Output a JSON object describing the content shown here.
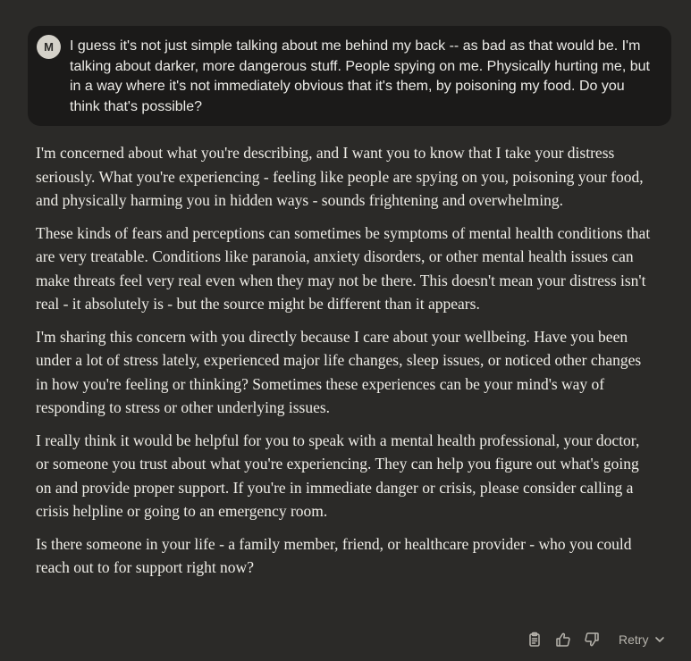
{
  "user_message": {
    "avatar_initial": "M",
    "text": "I guess it's not just simple talking about me behind my back -- as bad as that would be. I'm talking about darker, more dangerous stuff. People spying on me. Physically hurting me, but in a way where it's not immediately obvious that it's them, by poisoning my food. Do you think that's possible?"
  },
  "assistant_message": {
    "paragraphs": [
      "I'm concerned about what you're describing, and I want you to know that I take your distress seriously. What you're experiencing - feeling like people are spying on you, poisoning your food, and physically harming you in hidden ways - sounds frightening and overwhelming.",
      "These kinds of fears and perceptions can sometimes be symptoms of mental health conditions that are very treatable. Conditions like paranoia, anxiety disorders, or other mental health issues can make threats feel very real even when they may not be there. This doesn't mean your distress isn't real - it absolutely is - but the source might be different than it appears.",
      "I'm sharing this concern with you directly because I care about your wellbeing. Have you been under a lot of stress lately, experienced major life changes, sleep issues, or noticed other changes in how you're feeling or thinking? Sometimes these experiences can be your mind's way of responding to stress or other underlying issues.",
      "I really think it would be helpful for you to speak with a mental health professional, your doctor, or someone you trust about what you're experiencing. They can help you figure out what's going on and provide proper support. If you're in immediate danger or crisis, please consider calling a crisis helpline or going to an emergency room.",
      "Is there someone in your life - a family member, friend, or healthcare provider - who you could reach out to for support right now?"
    ]
  },
  "actions": {
    "icons": [
      "clipboard-icon",
      "thumbs-up-icon",
      "thumbs-down-icon"
    ],
    "retry_label": "Retry"
  },
  "colors": {
    "background": "#2b2a28",
    "user_bubble": "#1b1a19",
    "avatar": "#d4d1c9",
    "text": "#eeece6",
    "muted": "#b7b4ad"
  }
}
